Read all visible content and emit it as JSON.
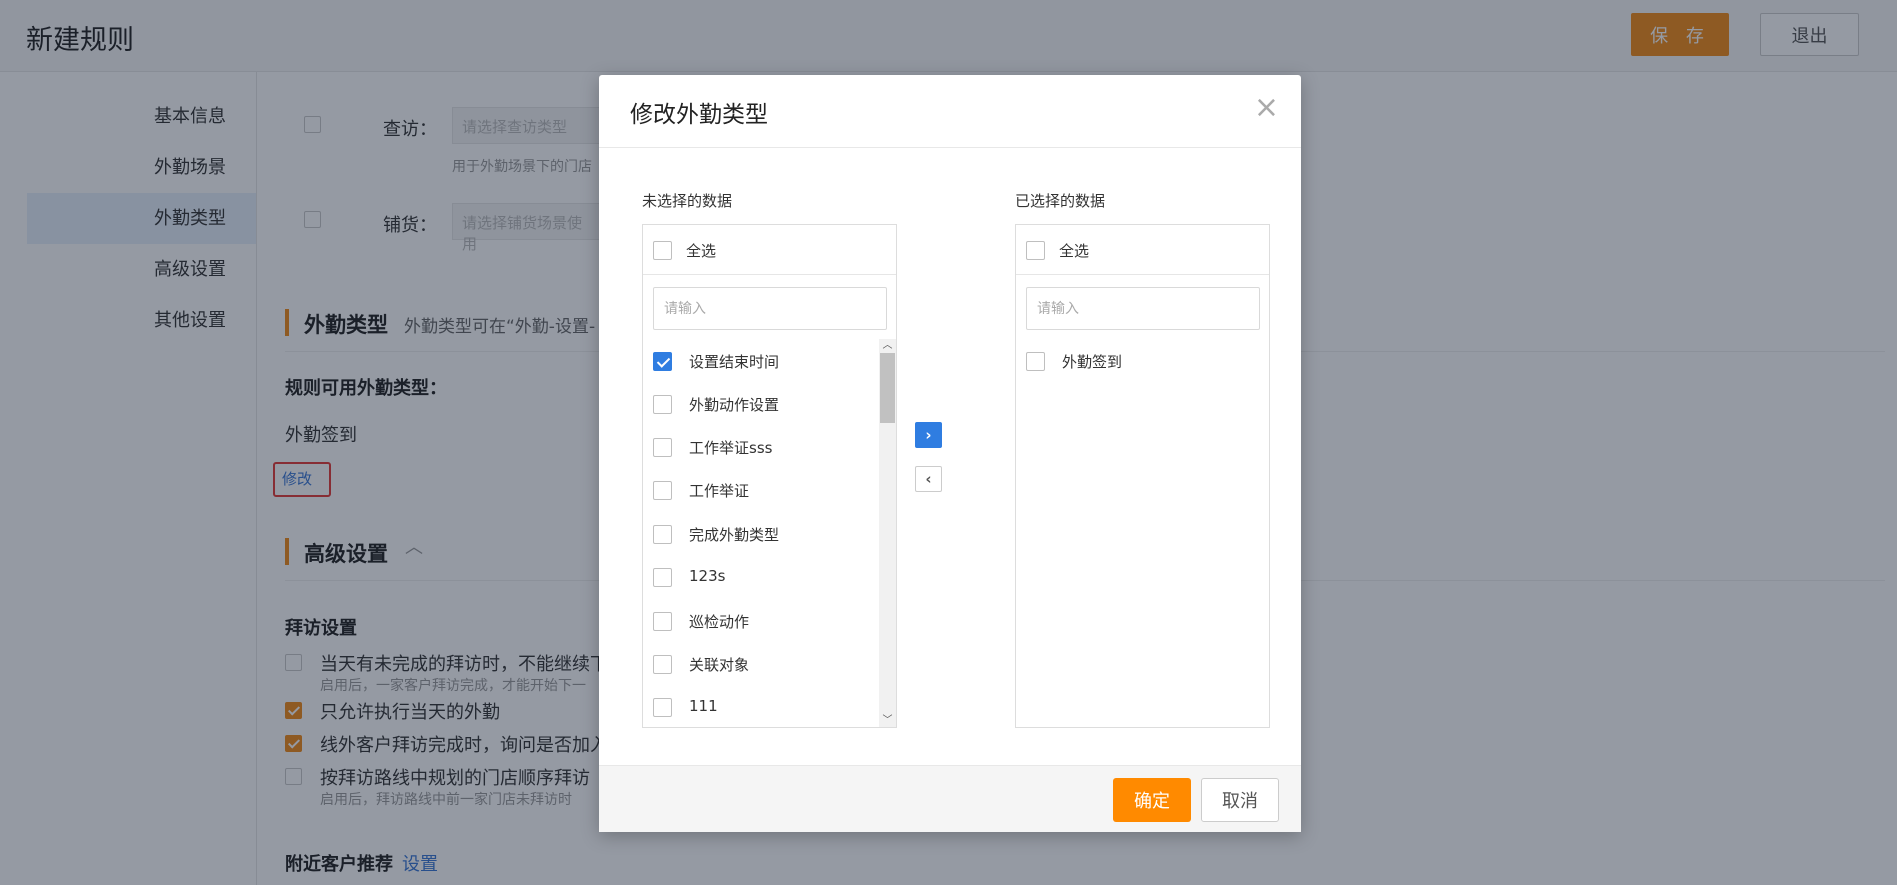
{
  "header": {
    "title": "新建规则",
    "save_label": "保 存",
    "exit_label": "退出"
  },
  "sidebar": {
    "items": [
      {
        "label": "基本信息"
      },
      {
        "label": "外勤场景"
      },
      {
        "label": "外勤类型",
        "active": true
      },
      {
        "label": "高级设置"
      },
      {
        "label": "其他设置"
      }
    ]
  },
  "main": {
    "visit_label": "查访：",
    "visit_placeholder": "请选择查访类型",
    "visit_hint": "用于外勤场景下的门店",
    "stock_label": "铺货：",
    "stock_placeholder": "请选择铺货场景使用",
    "type_section_title": "外勤类型",
    "type_section_desc": "外勤类型可在“外勤-设置-",
    "available_types_label": "规则可用外勤类型：",
    "available_types_value": "外勤签到",
    "edit_label": "修改",
    "advanced_section_title": "高级设置",
    "visit_settings_title": "拜访设置",
    "options": [
      {
        "label": "当天有未完成的拜访时，不能继续下",
        "hint": "启用后，一家客户拜访完成，才能开始下一",
        "checked": false
      },
      {
        "label": "只允许执行当天的外勤",
        "checked": true
      },
      {
        "label": "线外客户拜访完成时，询问是否加入",
        "checked": true
      },
      {
        "label": "按拜访路线中规划的门店顺序拜访",
        "hint": "启用后，拜访路线中前一家门店未拜访时",
        "checked": false
      }
    ],
    "nearby_label": "附近客户推荐",
    "nearby_link": "设置"
  },
  "dialog": {
    "title": "修改外勤类型",
    "close": "×",
    "left": {
      "label": "未选择的数据",
      "select_all": "全选",
      "search_placeholder": "请输入",
      "items": [
        {
          "label": "设置结束时间",
          "checked": true
        },
        {
          "label": "外勤动作设置",
          "checked": false
        },
        {
          "label": "工作举证sss",
          "checked": false
        },
        {
          "label": "工作举证",
          "checked": false
        },
        {
          "label": "完成外勤类型",
          "checked": false
        },
        {
          "label": "123s",
          "checked": false
        },
        {
          "label": "巡检动作",
          "checked": false
        },
        {
          "label": "关联对象",
          "checked": false
        },
        {
          "label": "111",
          "checked": false
        }
      ]
    },
    "right": {
      "label": "已选择的数据",
      "select_all": "全选",
      "search_placeholder": "请输入",
      "items": [
        {
          "label": "外勤签到",
          "checked": false
        }
      ]
    },
    "move_right": "›",
    "move_left": "‹",
    "ok_label": "确定",
    "cancel_label": "取消"
  },
  "colors": {
    "accent_orange": "#f28b17",
    "primary_blue": "#2f7de1",
    "danger_red": "#e53935"
  }
}
